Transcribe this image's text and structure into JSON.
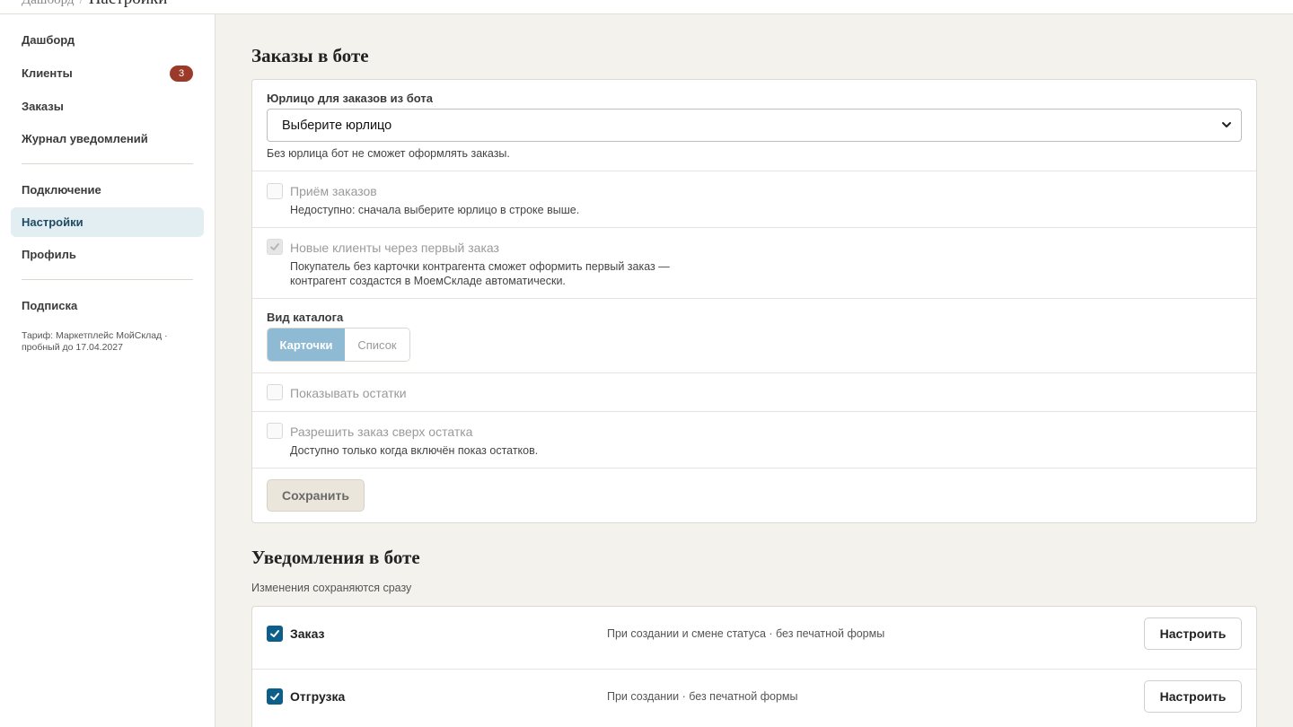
{
  "breadcrumb": {
    "parent": "Дашборд",
    "separator": "/",
    "current": "Настройки"
  },
  "sidebar": {
    "items": [
      {
        "label": "Дашборд"
      },
      {
        "label": "Клиенты",
        "badge": "3"
      },
      {
        "label": "Заказы"
      },
      {
        "label": "Журнал уведомлений"
      },
      {
        "label": "Подключение"
      },
      {
        "label": "Настройки",
        "active": true
      },
      {
        "label": "Профиль"
      },
      {
        "label": "Подписка"
      }
    ],
    "tariff": "Тариф: Маркетплейс МойСклад · пробный до 17.04.2027"
  },
  "orders": {
    "title": "Заказы в боте",
    "legal_entity": {
      "label": "Юрлицо для заказов из бота",
      "value": "Выберите юрлицо",
      "help": "Без юрлица бот не сможет оформлять заказы."
    },
    "accept_orders": {
      "label": "Приём заказов",
      "help": "Недоступно: сначала выберите юрлицо в строке выше.",
      "checked": false
    },
    "new_clients": {
      "label": "Новые клиенты через первый заказ",
      "help_line1": "Покупатель без карточки контрагента сможет оформить первый заказ —",
      "help_line2": "контрагент создастся в МоемСкладе автоматически.",
      "checked": true
    },
    "catalog_view": {
      "label": "Вид каталога",
      "options": [
        "Карточки",
        "Список"
      ],
      "selected": "Карточки"
    },
    "show_stock": {
      "label": "Показывать остатки",
      "checked": false
    },
    "allow_over_stock": {
      "label": "Разрешить заказ сверх остатка",
      "help": "Доступно только когда включён показ остатков.",
      "checked": false
    },
    "save_label": "Сохранить"
  },
  "notifications": {
    "title": "Уведомления в боте",
    "subtitle": "Изменения сохраняются сразу",
    "items": [
      {
        "label": "Заказ",
        "description": "При создании и смене статуса · без печатной формы",
        "checked": true,
        "button": "Настроить"
      },
      {
        "label": "Отгрузка",
        "description": "При создании · без печатной формы",
        "checked": true,
        "button": "Настроить"
      }
    ]
  },
  "colors": {
    "accent": "#0d5f8b",
    "badge": "#9c3a2a",
    "active_nav_bg": "#e3eef3",
    "page_bg": "#f4f2ed"
  }
}
